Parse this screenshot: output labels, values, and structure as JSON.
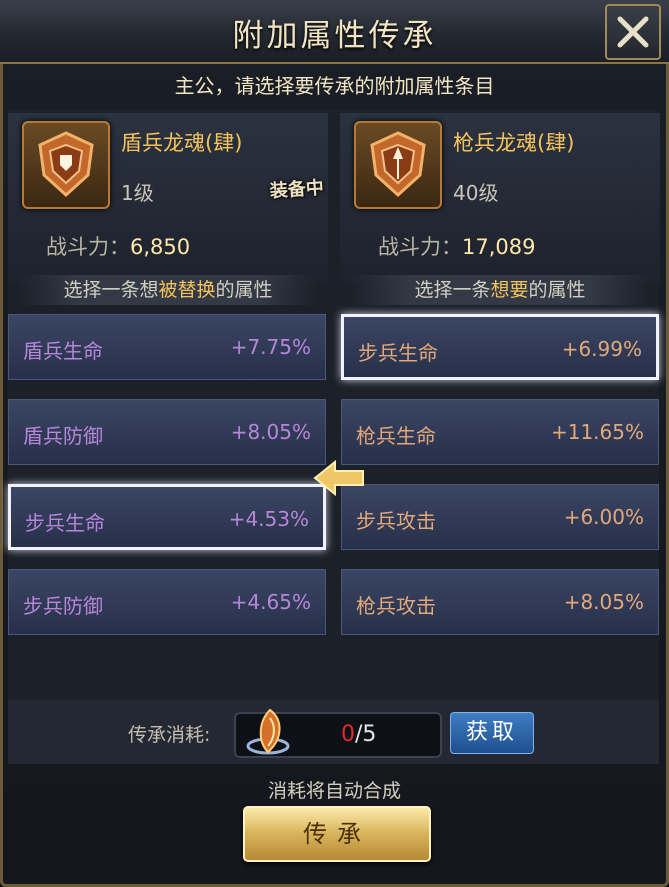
{
  "dialog": {
    "title": "附加属性传承",
    "subtitle": "主公，请选择要传承的附加属性条目"
  },
  "left": {
    "name": "盾兵龙魂(肆)",
    "level": "1级",
    "power_label": "战斗力：",
    "power": "6,850",
    "equip_badge": "装备中",
    "pick_a": "选择一条想",
    "pick_hl": "被替换",
    "pick_b": "的属性",
    "attrs": [
      {
        "name": "盾兵生命",
        "value": "+7.75%"
      },
      {
        "name": "盾兵防御",
        "value": "+8.05%"
      },
      {
        "name": "步兵生命",
        "value": "+4.53%"
      },
      {
        "name": "步兵防御",
        "value": "+4.65%"
      }
    ],
    "selected_index": 2
  },
  "right": {
    "name": "枪兵龙魂(肆)",
    "level": "40级",
    "power_label": "战斗力：",
    "power": "17,089",
    "pick_a": "选择一条",
    "pick_hl": "想要",
    "pick_b": "的属性",
    "attrs": [
      {
        "name": "步兵生命",
        "value": "+6.99%"
      },
      {
        "name": "枪兵生命",
        "value": "+11.65%"
      },
      {
        "name": "步兵攻击",
        "value": "+6.00%"
      },
      {
        "name": "枪兵攻击",
        "value": "+8.05%"
      }
    ],
    "selected_index": 0
  },
  "cost": {
    "label": "传承消耗:",
    "current": "0",
    "sep_total": "/5",
    "get_label": "获取"
  },
  "footer": {
    "auto_note": "消耗将自动合成",
    "inherit_label": "传承"
  },
  "colors": {
    "gold": "#f4c35b",
    "left_attr": "#b686d8",
    "right_attr": "#e3a87a",
    "cost_red": "#e02b2b"
  }
}
